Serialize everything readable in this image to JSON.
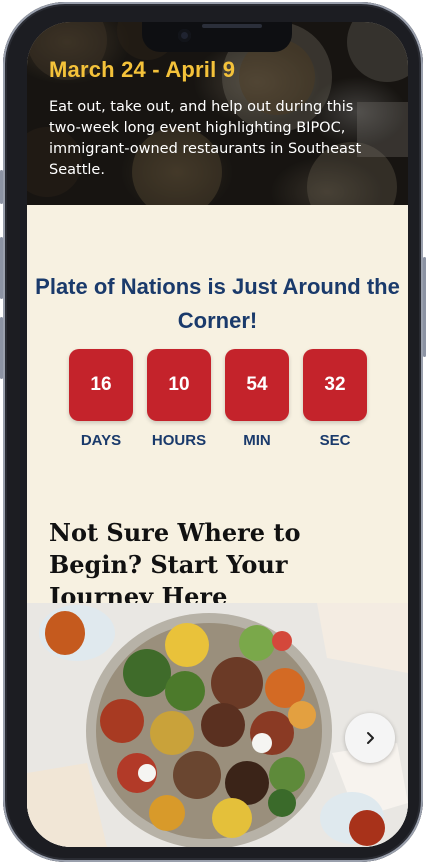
{
  "hero": {
    "date_range": "March 24 - April 9",
    "description": "Eat out, take out, and help out during this two-week long event highlighting BIPOC, immigrant-owned restaurants in Southeast Seattle."
  },
  "countdown": {
    "title": "Plate of Nations is Just Around the Corner!",
    "units": [
      {
        "value": "16",
        "label": "DAYS"
      },
      {
        "value": "10",
        "label": "HOURS"
      },
      {
        "value": "54",
        "label": "MIN"
      },
      {
        "value": "32",
        "label": "SEC"
      }
    ]
  },
  "journey": {
    "title": "Not Sure Where to Begin? Start Your Journey Here"
  },
  "carousel": {
    "next_icon": "chevron-right-icon"
  },
  "colors": {
    "accent_yellow": "#f4c23a",
    "navy": "#1a3a6b",
    "timer_red": "#c4232b",
    "cream": "#f7f1e1"
  }
}
